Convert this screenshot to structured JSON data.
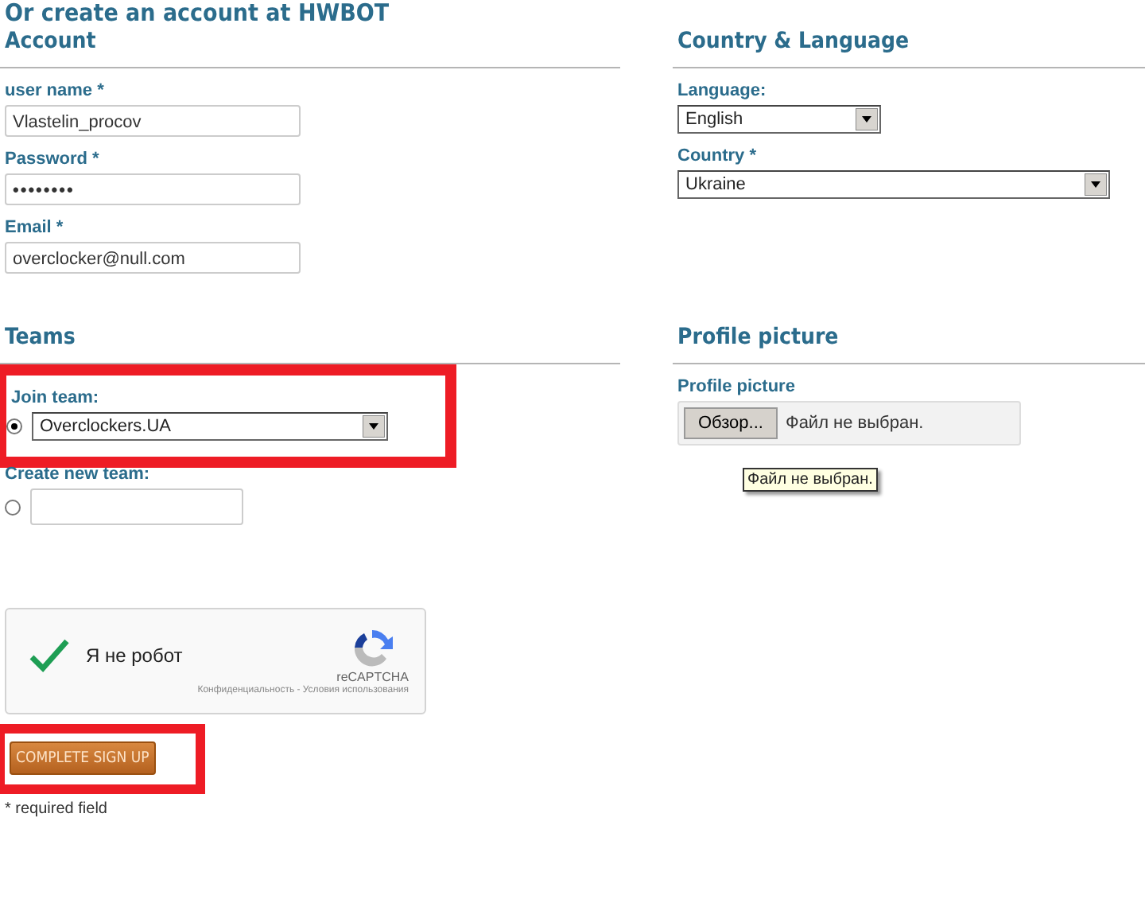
{
  "page_title": "Or create an account at HWBOT",
  "account": {
    "heading": "Account",
    "fields": [
      {
        "label": "user name *",
        "value": "Vlastelin_procov",
        "kind": "text"
      },
      {
        "label": "Password *",
        "value": "••••••••",
        "kind": "password"
      },
      {
        "label": "Email *",
        "value": "overclocker@null.com",
        "kind": "text"
      }
    ]
  },
  "country_language": {
    "heading": "Country & Language",
    "selects": [
      {
        "label": "Language:",
        "value": "English",
        "kind": "short"
      },
      {
        "label": "Country *",
        "value": "Ukraine",
        "kind": "long"
      }
    ]
  },
  "teams": {
    "heading": "Teams",
    "join": {
      "label": "Join team:",
      "selected": true,
      "value": "Overclockers.UA"
    },
    "create": {
      "label": "Create new team:",
      "selected": false
    }
  },
  "profile_picture": {
    "heading": "Profile picture",
    "label": "Profile picture",
    "browse_button": "Обзор...",
    "file_status": "Файл не выбран.",
    "tooltip": "Файл не выбран."
  },
  "captcha": {
    "checked": true,
    "label": "Я не робот",
    "brand": "reCAPTCHA",
    "footer": "Конфиденциальность - Условия использования"
  },
  "submit": "COMPLETE SIGN UP",
  "note": "* required field"
}
